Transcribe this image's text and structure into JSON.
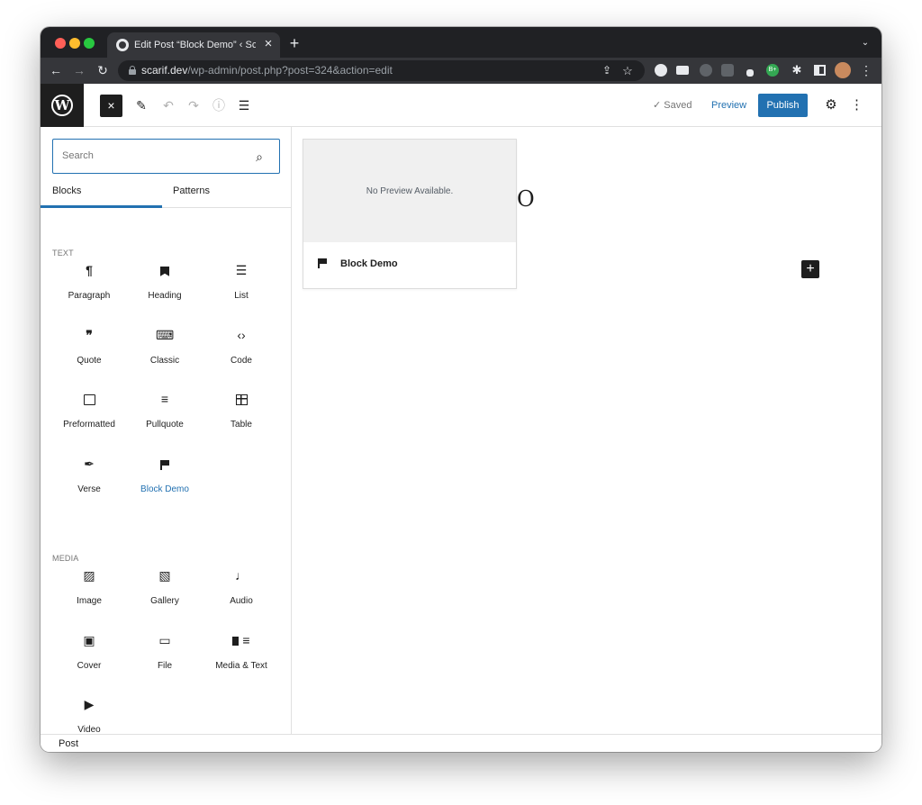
{
  "browser": {
    "tab_title": "Edit Post “Block Demo” ‹ Scarif",
    "tab_close": "×",
    "new_tab": "+",
    "tab_menu": "⌄",
    "back": "←",
    "forward": "→",
    "reload": "↻",
    "url_host": "scarif.dev",
    "url_path": "/wp-admin/post.php?post=324&action=edit",
    "share": "⇪",
    "star": "☆",
    "ext_badge": "B+",
    "puzzle": "✱",
    "menu": "⋮"
  },
  "wp_header": {
    "logo": "W",
    "close": "×",
    "pencil": "✎",
    "undo": "↶",
    "redo": "↷",
    "info": "ⓘ",
    "outline": "☰",
    "saved_label": "✓ Saved",
    "preview_label": "Preview",
    "publish_label": "Publish",
    "settings": "⚙",
    "more": "⋮"
  },
  "inserter": {
    "search_placeholder": "Search",
    "search_icon": "⌕",
    "tabs": [
      "Blocks",
      "Patterns"
    ],
    "sections": [
      {
        "label": "TEXT",
        "blocks": [
          {
            "label": "Paragraph",
            "icon": "¶"
          },
          {
            "label": "Heading",
            "icon": "heading"
          },
          {
            "label": "List",
            "icon": "☰"
          },
          {
            "label": "Quote",
            "icon": "❞"
          },
          {
            "label": "Classic",
            "icon": "⌨"
          },
          {
            "label": "Code",
            "icon": "‹›"
          },
          {
            "label": "Preformatted",
            "icon": "box"
          },
          {
            "label": "Pullquote",
            "icon": "≡"
          },
          {
            "label": "Table",
            "icon": "table"
          },
          {
            "label": "Verse",
            "icon": "✒"
          },
          {
            "label": "Block Demo",
            "icon": "flag",
            "accent": true
          }
        ]
      },
      {
        "label": "MEDIA",
        "blocks": [
          {
            "label": "Image",
            "icon": "▨"
          },
          {
            "label": "Gallery",
            "icon": "▧"
          },
          {
            "label": "Audio",
            "icon": "♩"
          },
          {
            "label": "Cover",
            "icon": "▣"
          },
          {
            "label": "File",
            "icon": "▭"
          },
          {
            "label": "Media & Text",
            "icon": "mediatext"
          },
          {
            "label": "Video",
            "icon": "▶"
          }
        ]
      }
    ]
  },
  "canvas": {
    "preview_empty": "No Preview Available.",
    "preview_block_title": "Block Demo",
    "behind_glyph": "O",
    "appender": "+"
  },
  "footer": {
    "breadcrumb": "Post"
  },
  "colors": {
    "accent": "#2271b1",
    "dark": "#1e1e1e",
    "chrome_dark": "#202124"
  }
}
